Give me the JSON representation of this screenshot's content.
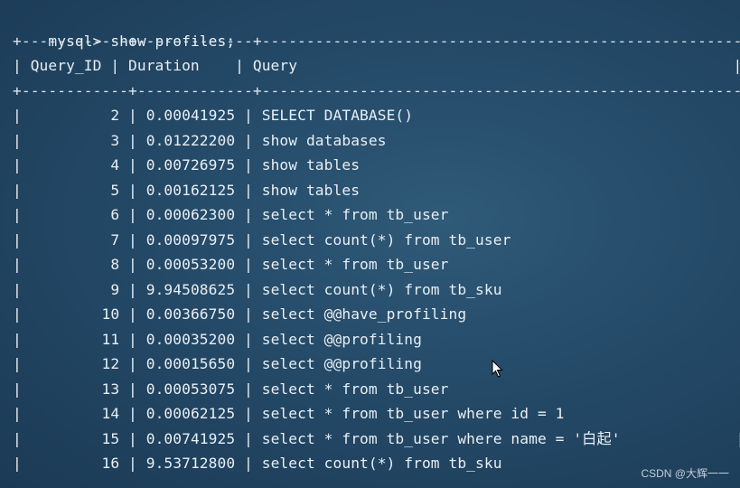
{
  "terminal": {
    "prompt": "mysql>",
    "command": "show profiles;",
    "border": "+------------+-------------+-------------------------------------------------------+",
    "headers": {
      "id": "Query_ID",
      "duration": "Duration",
      "query": "Query"
    },
    "rows": [
      {
        "id": "2",
        "duration": "0.00041925",
        "query": "SELECT DATABASE()"
      },
      {
        "id": "3",
        "duration": "0.01222200",
        "query": "show databases"
      },
      {
        "id": "4",
        "duration": "0.00726975",
        "query": "show tables"
      },
      {
        "id": "5",
        "duration": "0.00162125",
        "query": "show tables"
      },
      {
        "id": "6",
        "duration": "0.00062300",
        "query": "select * from tb_user"
      },
      {
        "id": "7",
        "duration": "0.00097975",
        "query": "select count(*) from tb_user"
      },
      {
        "id": "8",
        "duration": "0.00053200",
        "query": "select * from tb_user"
      },
      {
        "id": "9",
        "duration": "9.94508625",
        "query": "select count(*) from tb_sku"
      },
      {
        "id": "10",
        "duration": "0.00366750",
        "query": "select @@have_profiling"
      },
      {
        "id": "11",
        "duration": "0.00035200",
        "query": "select @@profiling"
      },
      {
        "id": "12",
        "duration": "0.00015650",
        "query": "select @@profiling"
      },
      {
        "id": "13",
        "duration": "0.00053075",
        "query": "select * from tb_user"
      },
      {
        "id": "14",
        "duration": "0.00062125",
        "query": "select * from tb_user where id = 1"
      },
      {
        "id": "15",
        "duration": "0.00741925",
        "query": "select * from tb_user where name = '白起'"
      },
      {
        "id": "16",
        "duration": "9.53712800",
        "query": "select count(*) from tb_sku"
      }
    ]
  },
  "watermark": "CSDN @大辉一一"
}
